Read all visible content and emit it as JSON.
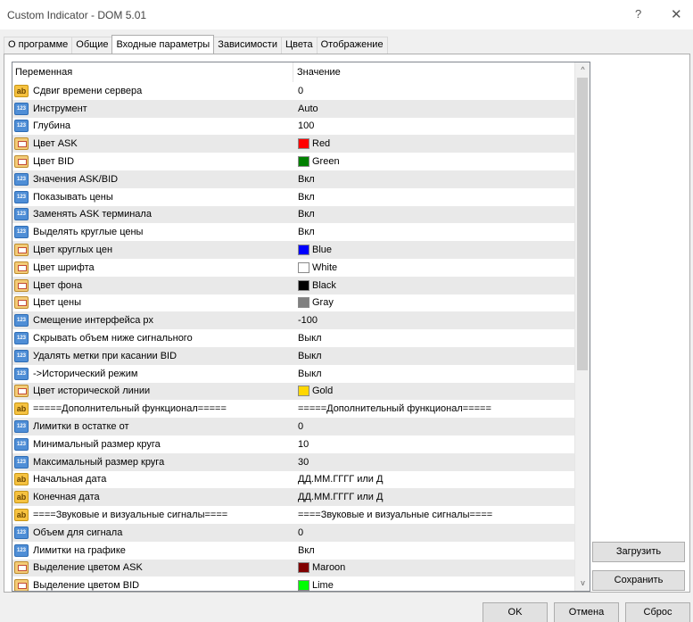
{
  "window": {
    "title": "Custom Indicator - DOM 5.01",
    "help_glyph": "?",
    "close_glyph": "✕"
  },
  "tabs": [
    {
      "label": "О программе",
      "active": false
    },
    {
      "label": "Общие",
      "active": false
    },
    {
      "label": "Входные параметры",
      "active": true
    },
    {
      "label": "Зависимости",
      "active": false
    },
    {
      "label": "Цвета",
      "active": false
    },
    {
      "label": "Отображение",
      "active": false
    }
  ],
  "table": {
    "col_variable": "Переменная",
    "col_value": "Значение",
    "rows": [
      {
        "icon": "ab",
        "name": "Сдвиг времени сервера",
        "value": "0"
      },
      {
        "icon": "num",
        "name": "Инструмент",
        "value": "Auto"
      },
      {
        "icon": "num",
        "name": "Глубина",
        "value": "100"
      },
      {
        "icon": "color",
        "name": "Цвет ASK",
        "value": "Red",
        "swatch": "#ff0000"
      },
      {
        "icon": "color",
        "name": "Цвет BID",
        "value": "Green",
        "swatch": "#008000"
      },
      {
        "icon": "num",
        "name": "Значения ASK/BID",
        "value": "Вкл"
      },
      {
        "icon": "num",
        "name": "Показывать цены",
        "value": "Вкл"
      },
      {
        "icon": "num",
        "name": "Заменять ASK терминала",
        "value": "Вкл"
      },
      {
        "icon": "num",
        "name": "Выделять круглые цены",
        "value": "Вкл"
      },
      {
        "icon": "color",
        "name": "Цвет круглых цен",
        "value": "Blue",
        "swatch": "#0000ff"
      },
      {
        "icon": "color",
        "name": "Цвет шрифта",
        "value": "White",
        "swatch": "#ffffff"
      },
      {
        "icon": "color",
        "name": "Цвет фона",
        "value": "Black",
        "swatch": "#000000"
      },
      {
        "icon": "color",
        "name": "Цвет цены",
        "value": "Gray",
        "swatch": "#808080"
      },
      {
        "icon": "num",
        "name": "Смещение интерфейса px",
        "value": "-100"
      },
      {
        "icon": "num",
        "name": "Скрывать объем ниже сигнального",
        "value": "Выкл"
      },
      {
        "icon": "num",
        "name": "Удалять метки при касании BID",
        "value": "Выкл"
      },
      {
        "icon": "num",
        "name": "->Исторический режим",
        "value": "Выкл"
      },
      {
        "icon": "color",
        "name": "Цвет исторической линии",
        "value": "Gold",
        "swatch": "#ffd700"
      },
      {
        "icon": "ab",
        "name": "=====Дополнительный функционал=====",
        "value": "=====Дополнительный функционал====="
      },
      {
        "icon": "num",
        "name": "Лимитки в остатке от",
        "value": "0"
      },
      {
        "icon": "num",
        "name": "Минимальный размер круга",
        "value": "10"
      },
      {
        "icon": "num",
        "name": "Максимальный размер круга",
        "value": "30"
      },
      {
        "icon": "ab",
        "name": "Начальная дата",
        "value": "ДД.ММ.ГГГГ или Д"
      },
      {
        "icon": "ab",
        "name": "Конечная дата",
        "value": "ДД.ММ.ГГГГ или Д"
      },
      {
        "icon": "ab",
        "name": "====Звуковые и визуальные сигналы====",
        "value": "====Звуковые и визуальные сигналы===="
      },
      {
        "icon": "num",
        "name": "Объем для сигнала",
        "value": "0"
      },
      {
        "icon": "num",
        "name": "Лимитки на графике",
        "value": "Вкл"
      },
      {
        "icon": "color",
        "name": "Выделение цветом ASK",
        "value": "Maroon",
        "swatch": "#800000"
      },
      {
        "icon": "color",
        "name": "Выделение цветом BID",
        "value": "Lime",
        "swatch": "#00ff00"
      }
    ]
  },
  "buttons": {
    "load": "Загрузить",
    "save": "Сохранить",
    "ok": "OK",
    "cancel": "Отмена",
    "reset": "Сброс"
  },
  "scrollbar": {
    "up": "^",
    "down": "v"
  }
}
